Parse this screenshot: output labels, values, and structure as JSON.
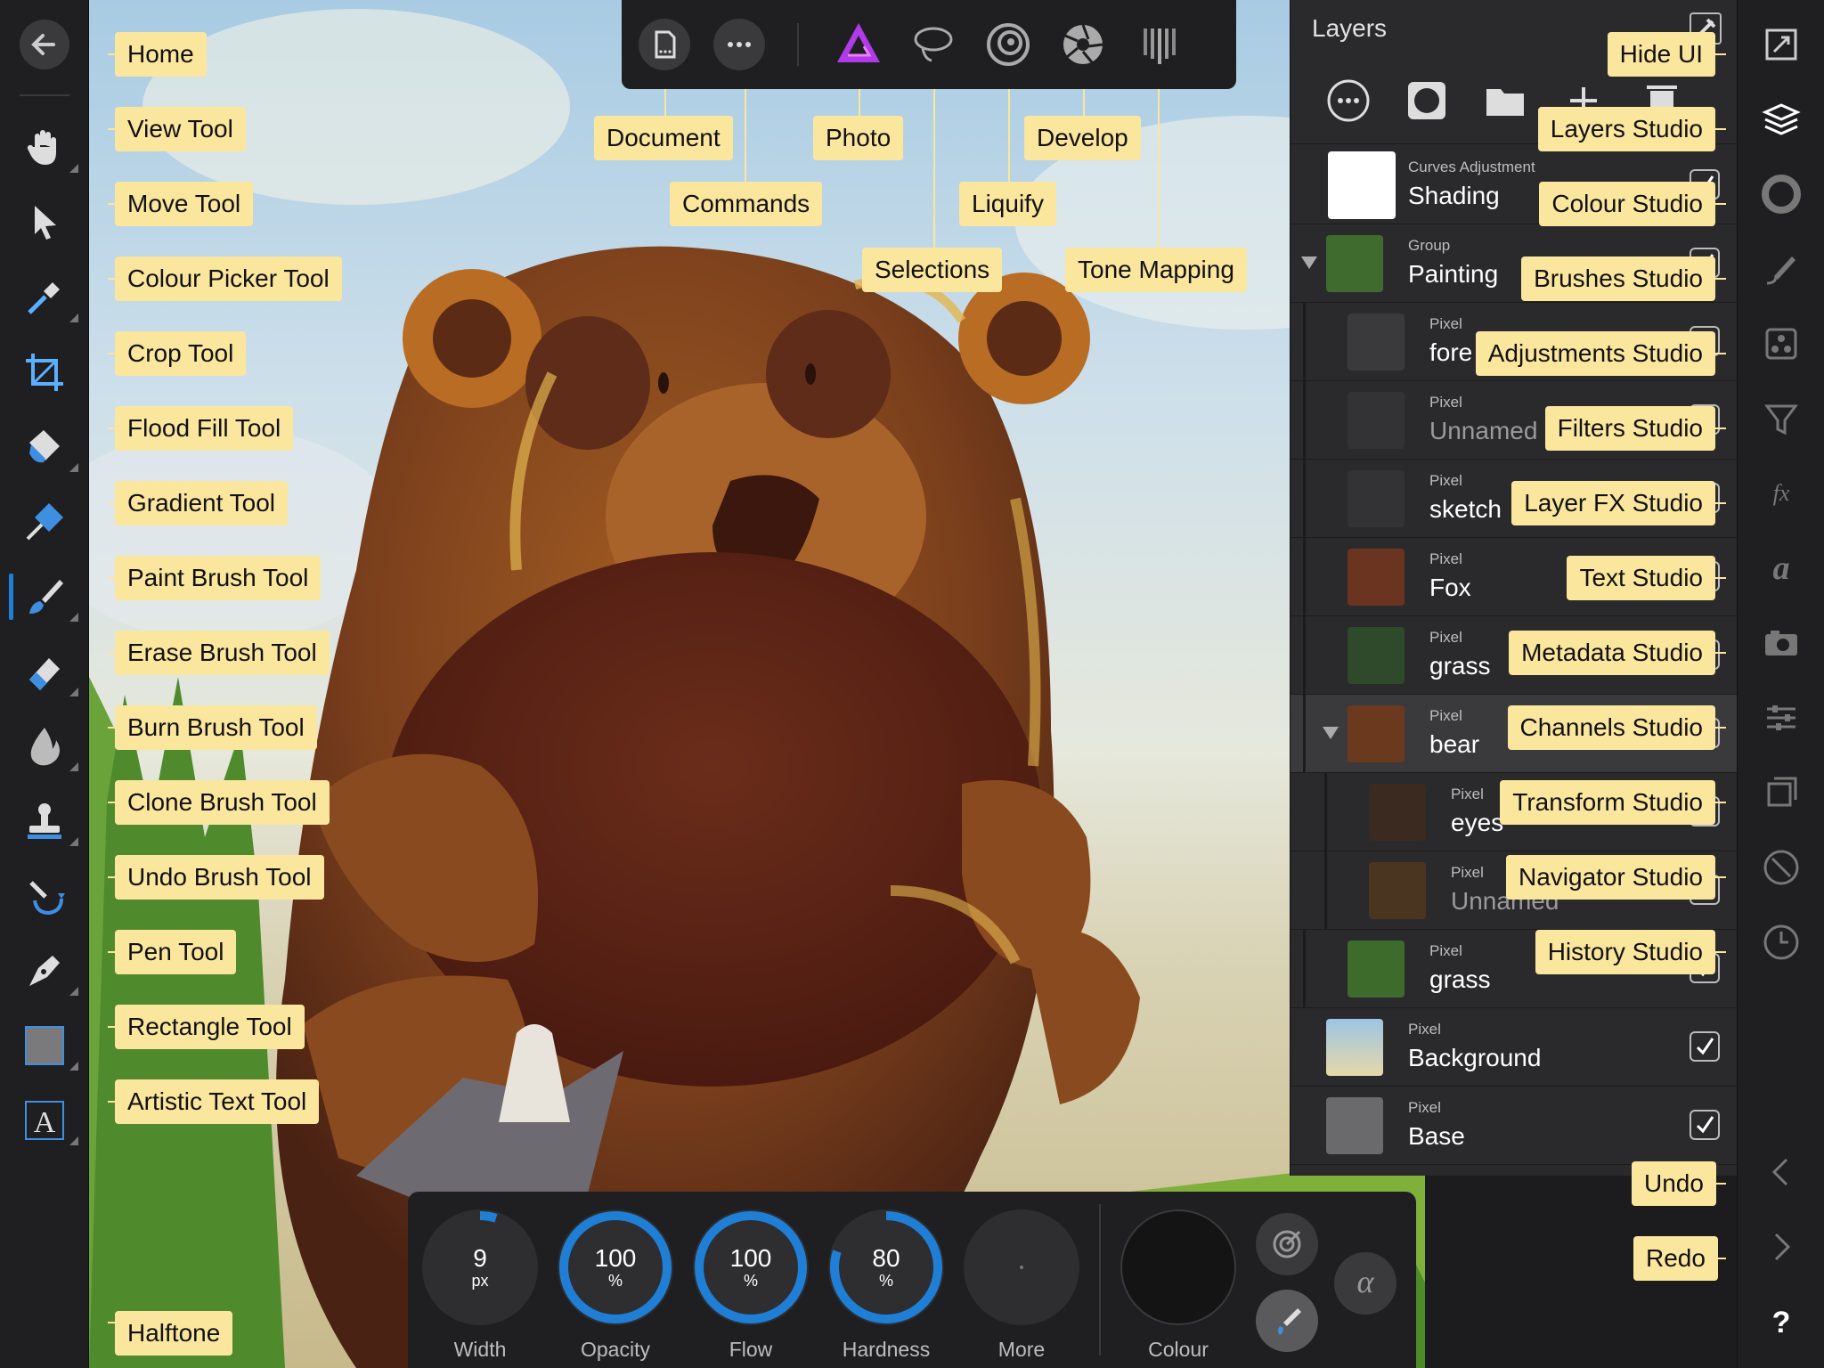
{
  "left_tools": [
    {
      "name": "back",
      "icon": "back-arrow-icon"
    },
    {
      "name": "view",
      "icon": "hand-icon"
    },
    {
      "name": "move",
      "icon": "pointer-icon"
    },
    {
      "name": "colour-picker",
      "icon": "eyedropper-icon"
    },
    {
      "name": "crop",
      "icon": "crop-icon"
    },
    {
      "name": "flood-fill",
      "icon": "bucket-icon"
    },
    {
      "name": "gradient",
      "icon": "gradient-icon"
    },
    {
      "name": "paint-brush",
      "icon": "brush-icon"
    },
    {
      "name": "erase-brush",
      "icon": "eraser-icon"
    },
    {
      "name": "burn-brush",
      "icon": "flame-icon"
    },
    {
      "name": "clone-brush",
      "icon": "stamp-icon"
    },
    {
      "name": "undo-brush",
      "icon": "undo-brush-icon"
    },
    {
      "name": "pen",
      "icon": "pen-nib-icon"
    },
    {
      "name": "rectangle",
      "icon": "rectangle-icon"
    },
    {
      "name": "artistic-text",
      "icon": "text-icon"
    }
  ],
  "tool_callouts": [
    "Home",
    "View Tool",
    "Move Tool",
    "Colour Picker Tool",
    "Crop Tool",
    "Flood Fill Tool",
    "Gradient Tool",
    "Paint Brush Tool",
    "Erase Brush Tool",
    "Burn Brush Tool",
    "Clone Brush Tool",
    "Undo Brush Tool",
    "Pen Tool",
    "Rectangle Tool",
    "Artistic Text Tool"
  ],
  "halftone_callout": "Halftone",
  "top_callouts": {
    "document": "Document",
    "commands": "Commands",
    "photo": "Photo",
    "selections": "Selections",
    "liquify": "Liquify",
    "develop": "Develop",
    "tone_mapping": "Tone Mapping"
  },
  "studio_callouts": [
    "Hide UI",
    "Layers Studio",
    "Colour Studio",
    "Brushes Studio",
    "Adjustments Studio",
    "Filters Studio",
    "Layer FX Studio",
    "Text Studio",
    "Metadata Studio",
    "Channels Studio",
    "Transform Studio",
    "Navigator Studio",
    "History Studio"
  ],
  "undo_callouts": [
    "Undo",
    "Redo"
  ],
  "layers_panel": {
    "title": "Layers",
    "rows": [
      {
        "kind": "Curves Adjustment",
        "name": "Shading"
      },
      {
        "kind": "Group",
        "name": "Painting"
      },
      {
        "kind": "Pixel",
        "name": "fore"
      },
      {
        "kind": "Pixel",
        "name": "Unnamed"
      },
      {
        "kind": "Pixel",
        "name": "sketch"
      },
      {
        "kind": "Pixel",
        "name": "Fox"
      },
      {
        "kind": "Pixel",
        "name": "grass"
      },
      {
        "kind": "Pixel",
        "name": "bear"
      },
      {
        "kind": "Pixel",
        "name": "eyes"
      },
      {
        "kind": "Pixel",
        "name": "Unnamed"
      },
      {
        "kind": "Pixel",
        "name": "grass"
      },
      {
        "kind": "Pixel",
        "name": "Background"
      },
      {
        "kind": "Pixel",
        "name": "Base"
      }
    ]
  },
  "brush_controls": {
    "width": {
      "value": "9",
      "unit": "px",
      "label": "Width",
      "fraction": 0.05
    },
    "opacity": {
      "value": "100",
      "unit": "%",
      "label": "Opacity",
      "fraction": 1.0
    },
    "flow": {
      "value": "100",
      "unit": "%",
      "label": "Flow",
      "fraction": 1.0
    },
    "hardness": {
      "value": "80",
      "unit": "%",
      "label": "Hardness",
      "fraction": 0.8
    },
    "more": {
      "label": "More"
    },
    "colour": {
      "label": "Colour"
    }
  },
  "colors": {
    "accent": "#1f7fd6",
    "callout": "#fbe69e",
    "panel": "#2a2a2c",
    "toolbar": "#1f1f21"
  }
}
